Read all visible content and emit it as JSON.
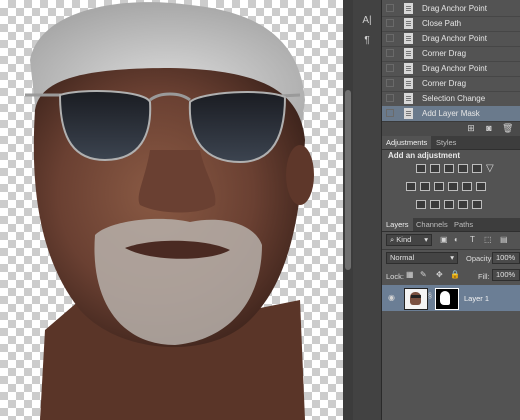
{
  "history": {
    "items": [
      {
        "label": "Drag Anchor Point",
        "active": false
      },
      {
        "label": "Close Path",
        "active": false
      },
      {
        "label": "Drag Anchor Point",
        "active": false
      },
      {
        "label": "Corner Drag",
        "active": false
      },
      {
        "label": "Drag Anchor Point",
        "active": false
      },
      {
        "label": "Corner Drag",
        "active": false
      },
      {
        "label": "Selection Change",
        "active": false
      },
      {
        "label": "Add Layer Mask",
        "active": true
      }
    ]
  },
  "adjustments": {
    "tabs": [
      "Adjustments",
      "Styles"
    ],
    "title": "Add an adjustment"
  },
  "layers": {
    "tabs": [
      "Layers",
      "Channels",
      "Paths"
    ],
    "kind_label": "Kind",
    "blend_mode": "Normal",
    "opacity_label": "Opacity:",
    "opacity_value": "100%",
    "lock_label": "Lock:",
    "fill_label": "Fill:",
    "fill_value": "100%",
    "layer_name": "Layer 1"
  },
  "icons": {
    "tool1": "character-icon",
    "tool2": "paragraph-icon"
  },
  "colors": {
    "panel_bg": "#535353",
    "selected_row": "#6b7e95"
  }
}
